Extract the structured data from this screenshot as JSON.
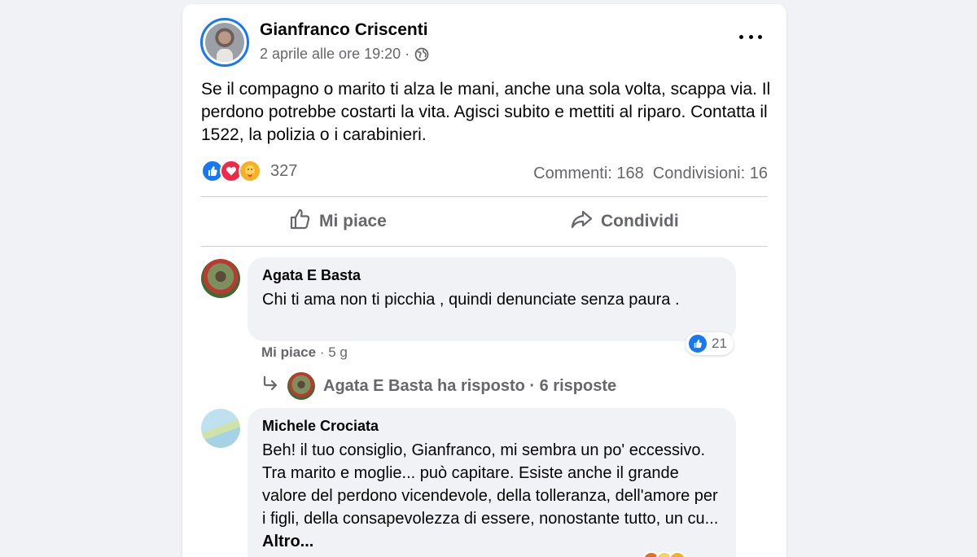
{
  "post": {
    "author": "Gianfranco Criscenti",
    "timestamp": "2 aprile alle ore 19:20 ·",
    "privacy_icon": "globe-icon",
    "text": "Se il compagno o marito ti alza le mani, anche una sola volta, scappa via. Il perdono potrebbe costarti la vita. Agisci subito e mettiti al riparo. Contatta il 1522, la polizia o i carabinieri.",
    "reactions": [
      "like",
      "love",
      "care"
    ],
    "reaction_count": "327",
    "comments_label": "Commenti: 168",
    "shares_label": "Condivisioni: 16"
  },
  "actions": {
    "like_label": "Mi piace",
    "share_label": "Condividi"
  },
  "comments": [
    {
      "author": "Agata E Basta",
      "text": "Chi ti ama non ti picchia , quindi denunciate senza paura .",
      "like_link": "Mi piace",
      "age": "· 5 g",
      "reaction_count": "21",
      "replies_label": "Agata E Basta ha risposto · 6 risposte"
    },
    {
      "author": "Michele Crociata",
      "text": "Beh! il tuo consiglio, Gianfranco, mi sembra un po' eccessivo. Tra marito e moglie... può capitare. Esiste anche il grande valore del perdono vicendevole, della tolleranza, dell'amore per i figli, della consapevolezza di essere, nonostante tutto, un cu...",
      "more_label": "Altro..."
    }
  ],
  "colors": {
    "accent": "#1877f2",
    "love": "#f02849",
    "care": "#f7b125",
    "secondary_text": "#65676b",
    "bubble": "#f0f2f5"
  }
}
